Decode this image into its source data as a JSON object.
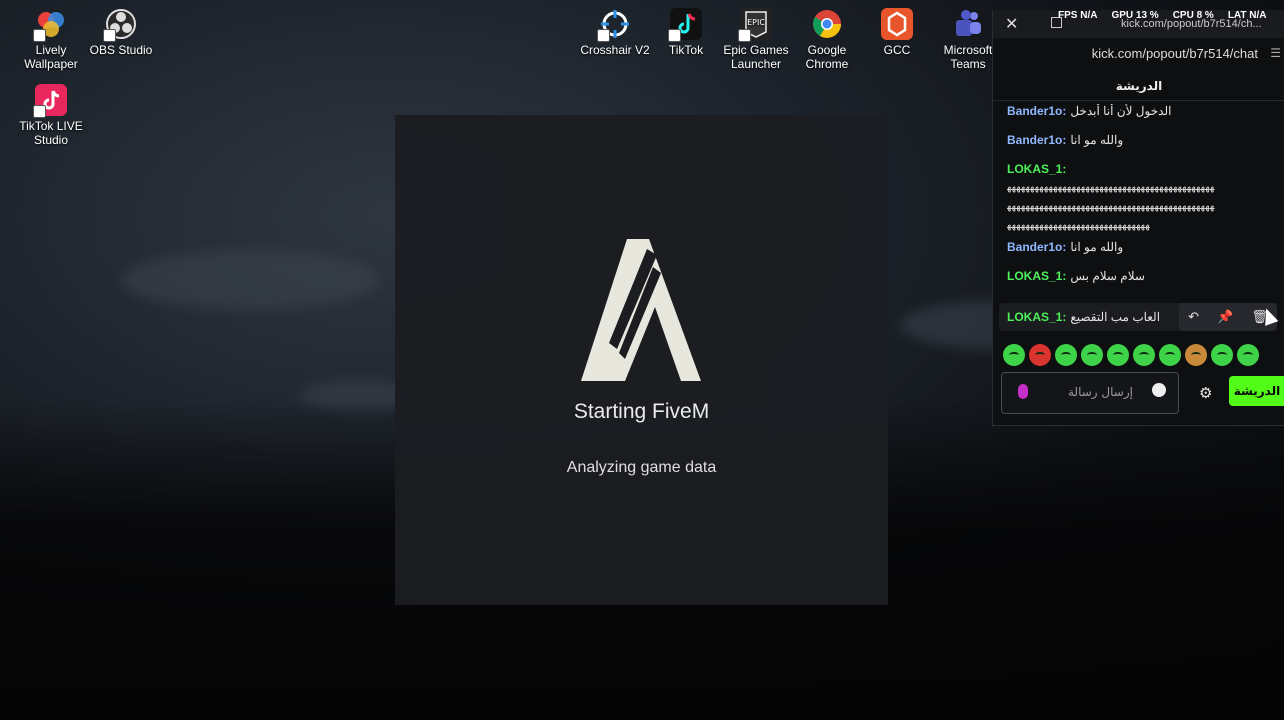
{
  "desktop": {
    "icons": [
      {
        "label": "Lively\nWallpaper",
        "icon": "lively-wallpaper-icon"
      },
      {
        "label": "OBS Studio",
        "icon": "obs-icon"
      },
      {
        "label": "TikTok LIVE\nStudio",
        "icon": "tiktok-live-icon"
      },
      {
        "label": "Crosshair V2",
        "icon": "crosshair-icon"
      },
      {
        "label": "TikTok",
        "icon": "tiktok-icon"
      },
      {
        "label": "Epic Games\nLauncher",
        "icon": "epic-games-icon"
      },
      {
        "label": "Google\nChrome",
        "icon": "chrome-icon"
      },
      {
        "label": "GCC",
        "icon": "gcc-icon"
      },
      {
        "label": "Microsoft\nTeams",
        "icon": "teams-icon"
      }
    ]
  },
  "splash": {
    "title": "Starting FiveM",
    "status": "Analyzing game data"
  },
  "perf": {
    "fps": "FPS  N/A",
    "gpu": "GPU  13 %",
    "cpu": "CPU  8 %",
    "lat": "LAT  N/A"
  },
  "chat": {
    "tab_title": "kick.com/popout/b7r514/ch...",
    "url": "kick.com/popout/b7r514/chat",
    "header": "الدريشة",
    "messages": [
      {
        "user": "Bander1o:",
        "text": "الدخول لأن أنا أبدخل",
        "color": "bander"
      },
      {
        "user": "Bander1o:",
        "text": "والله مو انا",
        "color": "bander"
      },
      {
        "user": "LOKAS_1:",
        "text": "",
        "color": "lokas"
      },
      {
        "user": "Bander1o:",
        "text": "والله مو انا",
        "color": "bander"
      },
      {
        "user": "LOKAS_1:",
        "text": "سلام سلام بس",
        "color": "lokas"
      }
    ],
    "spam_lines": [
      "ﻬﻬﻬﻬﻬﻬﻬﻬﻬﻬﻬﻬﻬﻬﻬﻬﻬﻬﻬﻬﻬﻬﻬﻬﻬﻬﻬﻬﻬﻬﻬﻬﻬﻬﻬﻬﻬﻬﻬﻬﻬﻬﻬﻬﻬ",
      "ﻬﻬﻬﻬﻬﻬﻬﻬﻬﻬﻬﻬﻬﻬﻬﻬﻬﻬﻬﻬﻬﻬﻬﻬﻬﻬﻬﻬﻬﻬﻬﻬﻬﻬﻬﻬﻬﻬﻬﻬﻬﻬﻬﻬﻬ",
      "ﻬﻬﻬﻬﻬﻬﻬﻬﻬﻬﻬﻬﻬﻬﻬﻬﻬﻬﻬﻬﻬﻬﻬﻬﻬﻬﻬﻬﻬﻬﻬ"
    ],
    "hovered_message": {
      "user": "LOKAS_1:",
      "text": "العاب مب التقصيع"
    },
    "input_placeholder": "إرسال رسالة",
    "send_label": "الدريشة",
    "colors": {
      "bander": "#8fb9ff",
      "lokas": "#4df15a",
      "accent": "#53fc18"
    }
  }
}
